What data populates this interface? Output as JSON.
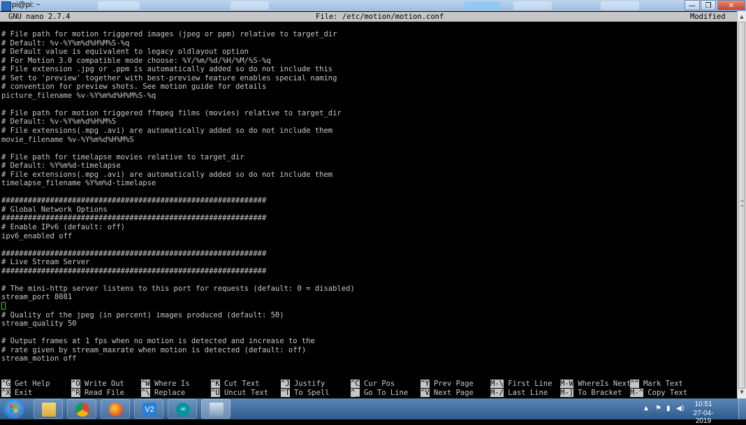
{
  "window": {
    "title": "pi@pi: ~",
    "minimize": "—",
    "restore": "❐",
    "close": "✕"
  },
  "nano": {
    "version": "GNU nano 2.7.4",
    "file": "File: /etc/motion/motion.conf",
    "status": "Modified",
    "lines": [
      "# File path for motion triggered images (jpeg or ppm) relative to target_dir",
      "# Default: %v-%Y%m%d%H%M%S-%q",
      "# Default value is equivalent to legacy oldlayout option",
      "# For Motion 3.0 compatible mode choose: %Y/%m/%d/%H/%M/%S-%q",
      "# File extension .jpg or .ppm is automatically added so do not include this",
      "# Set to 'preview' together with best-preview feature enables special naming",
      "# convention for preview shots. See motion guide for details",
      "picture_filename %v-%Y%m%d%H%M%S-%q",
      "",
      "# File path for motion triggered ffmpeg films (movies) relative to target_dir",
      "# Default: %v-%Y%m%d%H%M%S",
      "# File extensions(.mpg .avi) are automatically added so do not include them",
      "movie_filename %v-%Y%m%d%H%M%S",
      "",
      "# File path for timelapse movies relative to target_dir",
      "# Default: %Y%m%d-timelapse",
      "# File extensions(.mpg .avi) are automatically added so do not include them",
      "timelapse_filename %Y%m%d-timelapse",
      "",
      "############################################################",
      "# Global Network Options",
      "############################################################",
      "# Enable IPv6 (default: off)",
      "ipv6_enabled off",
      "",
      "############################################################",
      "# Live Stream Server",
      "############################################################",
      "",
      "# The mini-http server listens to this port for requests (default: 0 = disabled)",
      "stream_port 8081",
      "",
      "# Quality of the jpeg (in percent) images produced (default: 50)",
      "stream_quality 50",
      "",
      "# Output frames at 1 fps when no motion is detected and increase to the",
      "# rate given by stream_maxrate when motion is detected (default: off)",
      "stream_motion off"
    ],
    "shortcuts_row1": [
      {
        "key": "^G",
        "label": "Get Help"
      },
      {
        "key": "^O",
        "label": "Write Out"
      },
      {
        "key": "^W",
        "label": "Where Is"
      },
      {
        "key": "^K",
        "label": "Cut Text"
      },
      {
        "key": "^J",
        "label": "Justify"
      },
      {
        "key": "^C",
        "label": "Cur Pos"
      },
      {
        "key": "^Y",
        "label": "Prev Page"
      },
      {
        "key": "M-\\",
        "label": "First Line"
      },
      {
        "key": "M-W",
        "label": "WhereIs Next"
      },
      {
        "key": "^^",
        "label": "Mark Text"
      }
    ],
    "shortcuts_row2": [
      {
        "key": "^X",
        "label": "Exit"
      },
      {
        "key": "^R",
        "label": "Read File"
      },
      {
        "key": "^\\",
        "label": "Replace"
      },
      {
        "key": "^U",
        "label": "Uncut Text"
      },
      {
        "key": "^T",
        "label": "To Spell"
      },
      {
        "key": "^_",
        "label": "Go To Line"
      },
      {
        "key": "^V",
        "label": "Next Page"
      },
      {
        "key": "M-/",
        "label": "Last Line"
      },
      {
        "key": "M-]",
        "label": "To Bracket"
      },
      {
        "key": "M-^",
        "label": "Copy Text"
      }
    ]
  },
  "taskbar": {
    "apps": [
      "file-explorer",
      "chrome",
      "firefox",
      "vnc-viewer",
      "arduino",
      "putty"
    ],
    "clock_time": "10:51",
    "clock_date": "27-04-2019",
    "tray_expand": "▲"
  },
  "colors": {
    "terminal_bg": "#000000",
    "terminal_fg": "#c8c8c8",
    "bar_bg": "#c6c6c6",
    "cursor": "#33cc33"
  }
}
